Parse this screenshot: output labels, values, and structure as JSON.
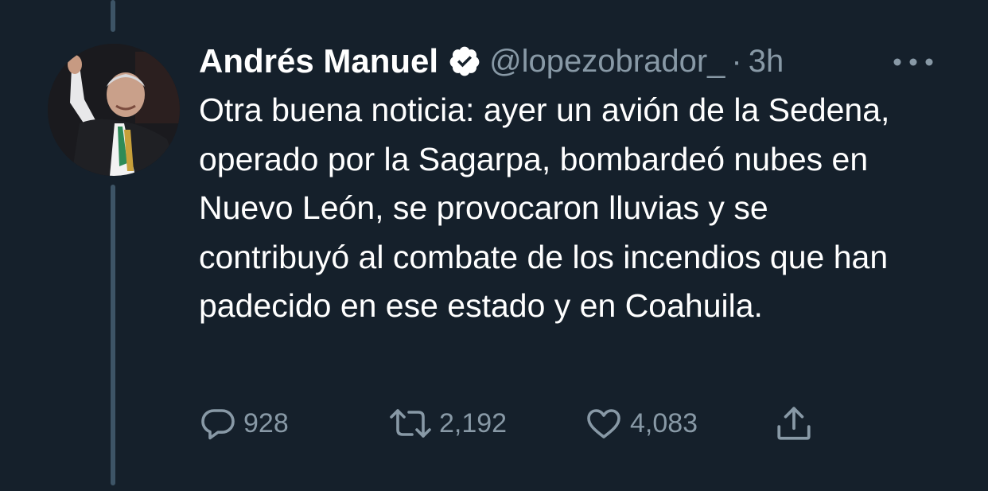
{
  "tweet": {
    "author_name": "Andrés Manuel",
    "handle": "@lopezobrador_",
    "separator": "·",
    "time": "3h",
    "text": "Otra buena noticia: ayer un avión de la Sedena, operado por la Sagarpa, bombardeó nubes en Nuevo León, se provocaron lluvias y se contribuyó al combate de los incendios que han padecido en ese estado y en Coahuila."
  },
  "actions": {
    "reply_count": "928",
    "retweet_count": "2,192",
    "like_count": "4,083"
  },
  "icons": {
    "verified": "verified-badge-icon",
    "more": "more-options-icon",
    "reply": "reply-icon",
    "retweet": "retweet-icon",
    "like": "heart-icon",
    "share": "share-icon"
  },
  "colors": {
    "background": "#15202b",
    "secondary_text": "#8899a6",
    "thread_line": "#3d5466"
  }
}
